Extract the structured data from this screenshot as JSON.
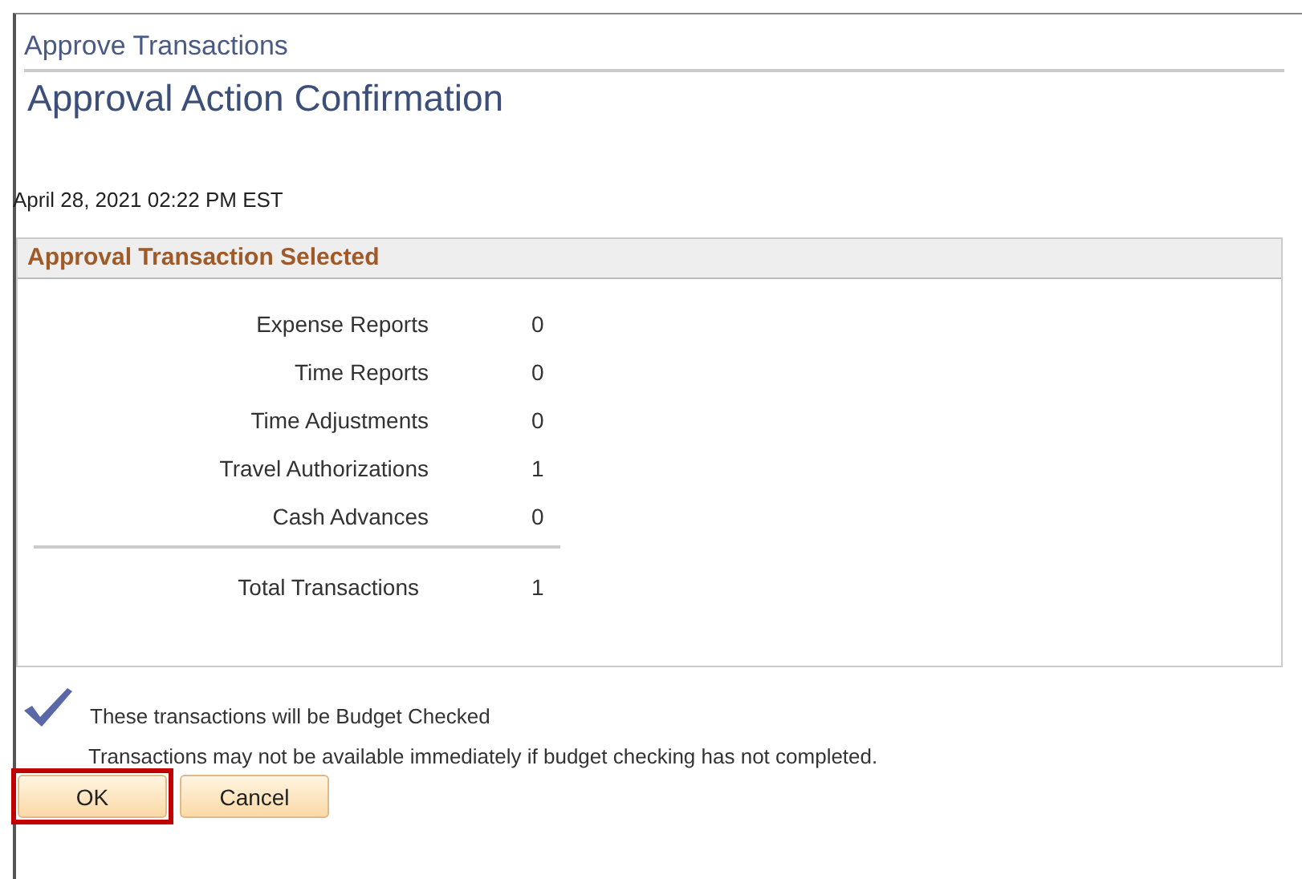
{
  "page_title": "Approve Transactions",
  "heading": "Approval Action Confirmation",
  "timestamp": "April 28, 2021 02:22 PM EST",
  "panel": {
    "title": "Approval Transaction Selected",
    "rows": [
      {
        "label": "Expense Reports",
        "value": "0"
      },
      {
        "label": "Time Reports",
        "value": "0"
      },
      {
        "label": "Time Adjustments",
        "value": "0"
      },
      {
        "label": "Travel Authorizations",
        "value": "1"
      },
      {
        "label": "Cash Advances",
        "value": "0"
      }
    ],
    "total": {
      "label": "Total Transactions",
      "value": "1"
    }
  },
  "messages": [
    "These transactions will be Budget Checked",
    "Transactions may not be available immediately if budget checking has not completed."
  ],
  "buttons": [
    {
      "label": "OK",
      "highlighted": true
    },
    {
      "label": "Cancel",
      "highlighted": false
    }
  ]
}
